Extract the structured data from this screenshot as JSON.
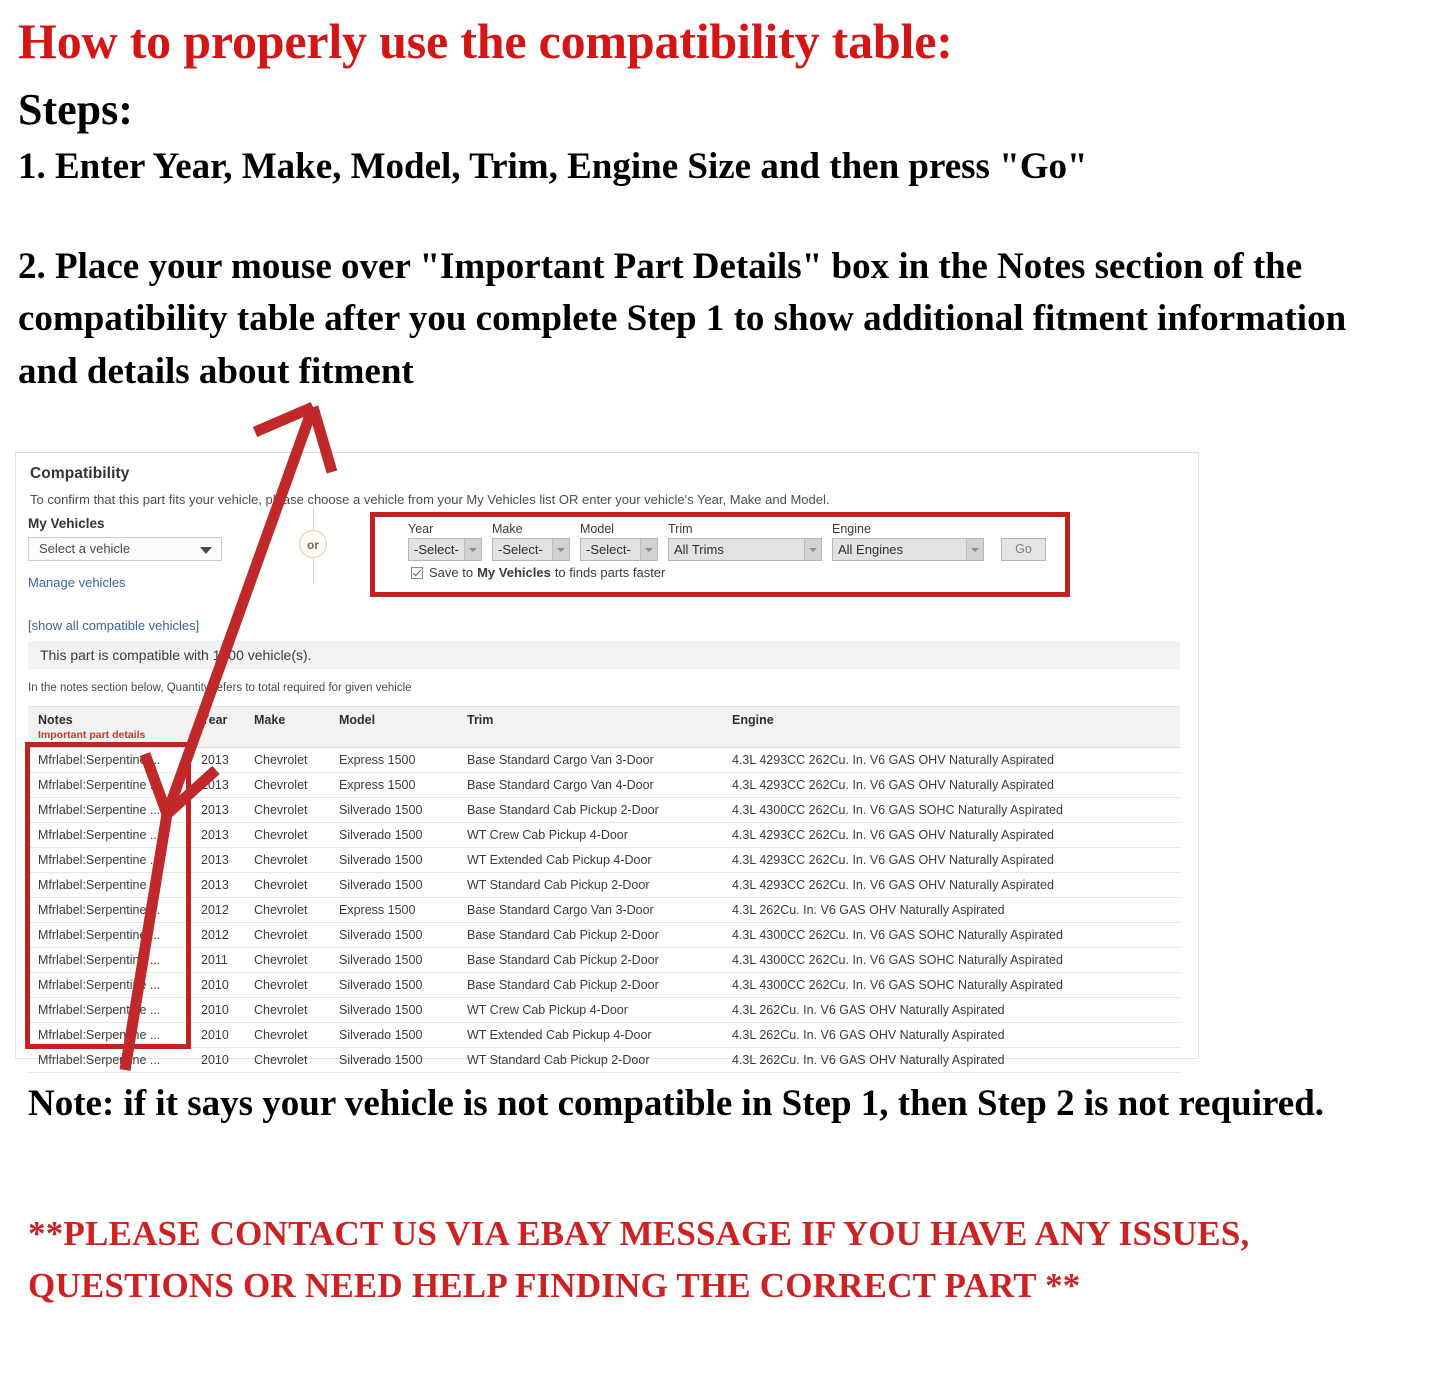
{
  "instructions": {
    "title": "How to properly use the compatibility table:",
    "steps_label": "Steps:",
    "step1": "1. Enter Year, Make, Model, Trim, Engine Size and then press \"Go\"",
    "step2": "2. Place your mouse over \"Important Part Details\" box in the Notes section of the compatibility table after you complete Step 1 to show additional fitment information and details about fitment",
    "note": "Note: if it says your vehicle is not compatible in Step 1, then Step 2 is not required.",
    "contact": "**PLEASE CONTACT US VIA EBAY MESSAGE IF YOU HAVE ANY ISSUES, QUESTIONS OR NEED HELP FINDING THE CORRECT PART **"
  },
  "panel": {
    "title": "Compatibility",
    "subtitle": "To confirm that this part fits your vehicle, please choose a vehicle from your My Vehicles list OR enter your vehicle's Year, Make and Model.",
    "my_vehicles": {
      "label": "My Vehicles",
      "select_value": "Select a vehicle",
      "manage_link": "Manage vehicles",
      "show_all_link": "[show all compatible vehicles]"
    },
    "or_divider": "or",
    "finder": {
      "year_label": "Year",
      "year_value": "-Select-",
      "make_label": "Make",
      "make_value": "-Select-",
      "model_label": "Model",
      "model_value": "-Select-",
      "trim_label": "Trim",
      "trim_value": "All Trims",
      "engine_label": "Engine",
      "engine_value": "All Engines",
      "go_label": "Go",
      "save_checkbox_checked": true,
      "save_text_before": "Save to",
      "save_text_bold": "My Vehicles",
      "save_text_after": "to finds parts faster"
    },
    "compat_count_text": "This part is compatible with 1000 vehicle(s).",
    "notes_hint": "In the notes section below, Quantity refers to total required for given vehicle",
    "table": {
      "headers": {
        "notes": "Notes",
        "notes_sub": "Important part details",
        "year": "Year",
        "make": "Make",
        "model": "Model",
        "trim": "Trim",
        "engine": "Engine"
      },
      "rows": [
        {
          "notes": "Mfrlabel:Serpentine ...",
          "year": "2013",
          "make": "Chevrolet",
          "model": "Express 1500",
          "trim": "Base Standard Cargo Van 3-Door",
          "engine": "4.3L 4293CC 262Cu. In. V6 GAS OHV Naturally Aspirated"
        },
        {
          "notes": "Mfrlabel:Serpentine ...",
          "year": "2013",
          "make": "Chevrolet",
          "model": "Express 1500",
          "trim": "Base Standard Cargo Van 4-Door",
          "engine": "4.3L 4293CC 262Cu. In. V6 GAS OHV Naturally Aspirated"
        },
        {
          "notes": "Mfrlabel:Serpentine ...",
          "year": "2013",
          "make": "Chevrolet",
          "model": "Silverado 1500",
          "trim": "Base Standard Cab Pickup 2-Door",
          "engine": "4.3L 4300CC 262Cu. In. V6 GAS SOHC Naturally Aspirated"
        },
        {
          "notes": "Mfrlabel:Serpentine ...",
          "year": "2013",
          "make": "Chevrolet",
          "model": "Silverado 1500",
          "trim": "WT Crew Cab Pickup 4-Door",
          "engine": "4.3L 4293CC 262Cu. In. V6 GAS OHV Naturally Aspirated"
        },
        {
          "notes": "Mfrlabel:Serpentine ...",
          "year": "2013",
          "make": "Chevrolet",
          "model": "Silverado 1500",
          "trim": "WT Extended Cab Pickup 4-Door",
          "engine": "4.3L 4293CC 262Cu. In. V6 GAS OHV Naturally Aspirated"
        },
        {
          "notes": "Mfrlabel:Serpentine ...",
          "year": "2013",
          "make": "Chevrolet",
          "model": "Silverado 1500",
          "trim": "WT Standard Cab Pickup 2-Door",
          "engine": "4.3L 4293CC 262Cu. In. V6 GAS OHV Naturally Aspirated"
        },
        {
          "notes": "Mfrlabel:Serpentine ...",
          "year": "2012",
          "make": "Chevrolet",
          "model": "Express 1500",
          "trim": "Base Standard Cargo Van 3-Door",
          "engine": "4.3L 262Cu. In. V6 GAS OHV Naturally Aspirated"
        },
        {
          "notes": "Mfrlabel:Serpentine ...",
          "year": "2012",
          "make": "Chevrolet",
          "model": "Silverado 1500",
          "trim": "Base Standard Cab Pickup 2-Door",
          "engine": "4.3L 4300CC 262Cu. In. V6 GAS SOHC Naturally Aspirated"
        },
        {
          "notes": "Mfrlabel:Serpentine ...",
          "year": "2011",
          "make": "Chevrolet",
          "model": "Silverado 1500",
          "trim": "Base Standard Cab Pickup 2-Door",
          "engine": "4.3L 4300CC 262Cu. In. V6 GAS SOHC Naturally Aspirated"
        },
        {
          "notes": "Mfrlabel:Serpentine ...",
          "year": "2010",
          "make": "Chevrolet",
          "model": "Silverado 1500",
          "trim": "Base Standard Cab Pickup 2-Door",
          "engine": "4.3L 4300CC 262Cu. In. V6 GAS SOHC Naturally Aspirated"
        },
        {
          "notes": "Mfrlabel:Serpentine ...",
          "year": "2010",
          "make": "Chevrolet",
          "model": "Silverado 1500",
          "trim": "WT Crew Cab Pickup 4-Door",
          "engine": "4.3L 262Cu. In. V6 GAS OHV Naturally Aspirated"
        },
        {
          "notes": "Mfrlabel:Serpentine ...",
          "year": "2010",
          "make": "Chevrolet",
          "model": "Silverado 1500",
          "trim": "WT Extended Cab Pickup 4-Door",
          "engine": "4.3L 262Cu. In. V6 GAS OHV Naturally Aspirated"
        },
        {
          "notes": "Mfrlabel:Serpentine ...",
          "year": "2010",
          "make": "Chevrolet",
          "model": "Silverado 1500",
          "trim": "WT Standard Cab Pickup 2-Door",
          "engine": "4.3L 262Cu. In. V6 GAS OHV Naturally Aspirated"
        }
      ]
    }
  },
  "annotations": {
    "highlight_color": "#c32222",
    "arrow_color": "#c0282a",
    "title_color": "#d41515",
    "contact_color": "#cc2222"
  }
}
